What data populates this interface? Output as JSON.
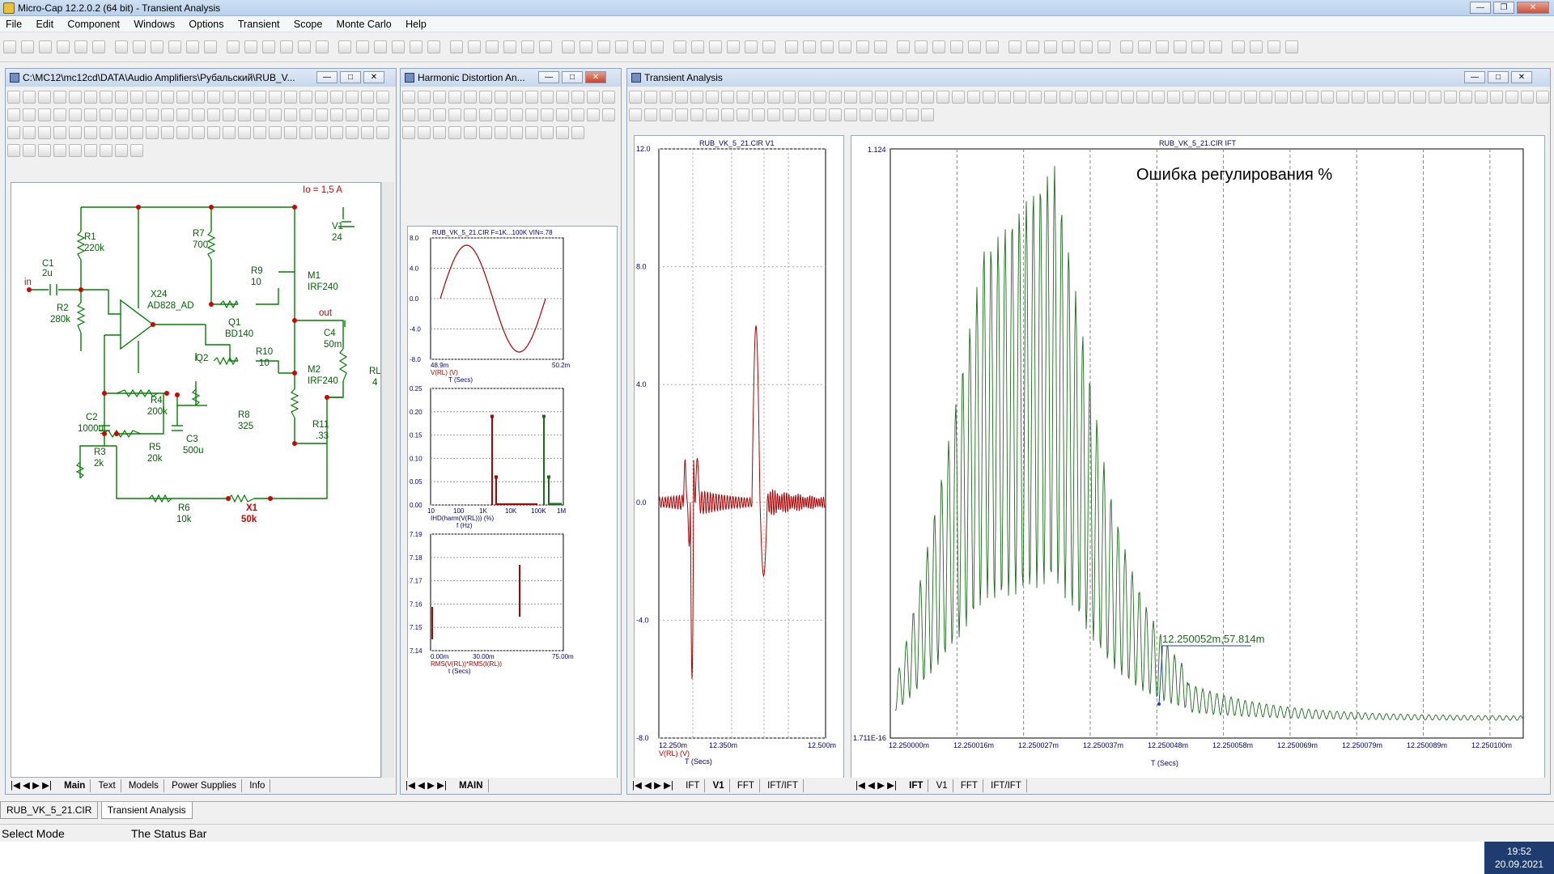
{
  "app": {
    "title": "Micro-Cap 12.2.0.2 (64 bit) - Transient Analysis"
  },
  "menu": [
    "File",
    "Edit",
    "Component",
    "Windows",
    "Options",
    "Transient",
    "Scope",
    "Monte Carlo",
    "Help"
  ],
  "schematic": {
    "title": "C:\\MC12\\mc12cd\\DATA\\Audio Amplifiers\\Рубальский\\RUB_V...",
    "annotation": "Io = 1,5 A",
    "labels": {
      "r1": "R1",
      "r1v": "220k",
      "c1": "C1",
      "c1v": "2u",
      "in": "in",
      "r2": "R2",
      "r2v": "280k",
      "x24": "X24",
      "x24v": "AD828_AD",
      "r7": "R7",
      "r7v": "700",
      "r9": "R9",
      "r9v": "10",
      "m1": "M1",
      "m1v": "IRF240",
      "v1": "V1",
      "v1v": "24",
      "q1": "Q1",
      "q1v": "BD140",
      "out": "out",
      "c4": "C4",
      "c4v": "50m",
      "r10": "R10",
      "r10v": "10",
      "q2": "Q2",
      "m2": "M2",
      "m2v": "IRF240",
      "rl": "RL",
      "rlv": "4",
      "c2": "C2",
      "c2v": "1000u",
      "r4": "R4",
      "r4v": "200k",
      "r8": "R8",
      "r8v": "325",
      "r11": "R11",
      "r11v": ".33",
      "r3": "R3",
      "r3v": "2k",
      "r5": "R5",
      "r5v": "20k",
      "c3": "C3",
      "c3v": "500u",
      "r6": "R6",
      "r6v": "10k",
      "x1": "X1",
      "x1v": "50k"
    },
    "tabs": [
      "Main",
      "Text",
      "Models",
      "Power Supplies",
      "Info"
    ],
    "active_tab": "Main"
  },
  "harmonic": {
    "title": "Harmonic Distortion An...",
    "tabs": [
      "MAIN"
    ],
    "plot1": {
      "title": "RUB_VK_5_21.CIR F=1K...100K VIN=.78",
      "y_ticks": [
        "8.0",
        "4.0",
        "0.0",
        "-4.0",
        "-8.0"
      ],
      "x_left": "48.9m",
      "x_right": "50.2m",
      "expr": "V(RL) (V)",
      "xlabel": "T (Secs)"
    },
    "plot2": {
      "y_ticks": [
        "0.25",
        "0.20",
        "0.15",
        "0.10",
        "0.05",
        "0.00"
      ],
      "x_ticks": [
        "10",
        "100",
        "1K",
        "10K",
        "100K",
        "1M"
      ],
      "expr": "IHD(harm(V(RL))) (%)",
      "xlabel": "f (Hz)"
    },
    "plot3": {
      "y_ticks": [
        "7.19",
        "7.18",
        "7.17",
        "7.16",
        "7.15",
        "7.14"
      ],
      "x_ticks": [
        "0.00m",
        "30.00m",
        "75.00m"
      ],
      "expr": "RMS(V(RL))*RMS(I(RL))",
      "xlabel": "t (Secs)"
    }
  },
  "transient": {
    "title": "Transient Analysis",
    "tabs": [
      "IFT",
      "V1",
      "FFT",
      "IFT/IFT"
    ],
    "left_plot": {
      "title": "RUB_VK_5_21.CIR V1",
      "y_ticks": [
        "12.0",
        "8.0",
        "4.0",
        "0.0",
        "-4.0",
        "-8.0"
      ],
      "x_ticks": [
        "12.250m",
        "12.350m",
        "12.500m"
      ],
      "expr": "V(RL) (V)",
      "xlabel": "T (Secs)",
      "active_tab": "V1"
    },
    "right_plot": {
      "title": "RUB_VK_5_21.CIR IFT",
      "y_top": "1.124",
      "y_bottom": "1.711E-16",
      "x_ticks": [
        "12.250000m",
        "12.250016m",
        "12.250027m",
        "12.250037m",
        "12.250048m",
        "12.250058m",
        "12.250069m",
        "12.250079m",
        "12.250089m",
        "12.250100m"
      ],
      "xlabel": "T (Secs)",
      "annotation": "Ошибка регулирования %",
      "marker": "12.250052m,57.814m",
      "active_tab": "IFT"
    }
  },
  "bottom_tabs": [
    "RUB_VK_5_21.CIR",
    "Transient Analysis"
  ],
  "status": {
    "left": "Select Mode",
    "right": "The Status Bar"
  },
  "clock": {
    "time": "19:52",
    "date": "20.09.2021"
  },
  "colors": {
    "schematic_wire": "#008000",
    "node": "#d00000",
    "trace_red": "#b00000",
    "trace_green": "#1a6e1a",
    "axis_text": "#000080"
  }
}
